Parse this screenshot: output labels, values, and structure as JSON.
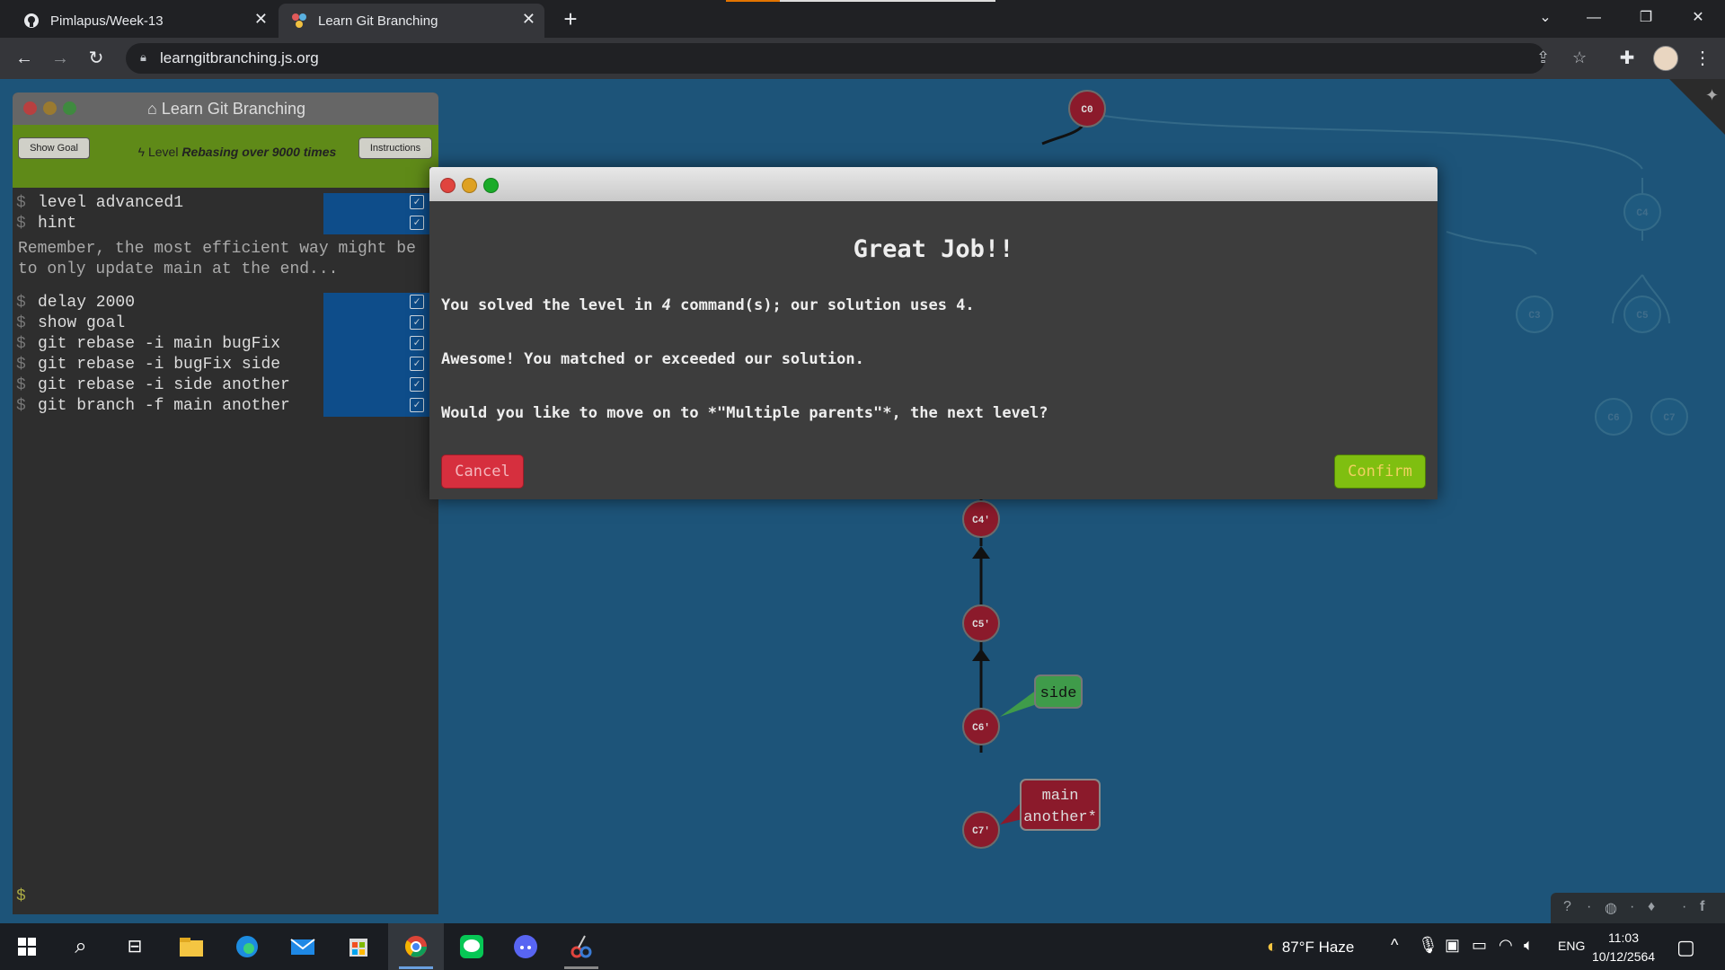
{
  "browser": {
    "tabs": [
      {
        "title": "Pimlapus/Week-13",
        "icon": "github-icon",
        "active": false
      },
      {
        "title": "Learn Git Branching",
        "icon": "lgb-icon",
        "active": true
      }
    ],
    "url": "learngitbranching.js.org"
  },
  "panel": {
    "title": "Learn Git Branching",
    "show_goal": "Show Goal",
    "instructions": "Instructions",
    "level_prefix": "Level",
    "level_name": "Rebasing over 9000 times",
    "commands_top": [
      "level advanced1",
      "hint"
    ],
    "hint": "Remember, the most efficient way might be to only update main at the end...",
    "commands": [
      "delay 2000",
      "show goal",
      "git rebase -i main bugFix",
      "git rebase -i bugFix side",
      "git rebase -i side another",
      "git branch -f main another"
    ],
    "prompt": "$"
  },
  "tree": {
    "commits": [
      "C0",
      "C4'",
      "C5'",
      "C6'",
      "C7'"
    ],
    "faded_commits": [
      "C4",
      "C3",
      "C5",
      "C6",
      "C7"
    ],
    "branches": {
      "side": "side",
      "main": "main",
      "another": "another*"
    },
    "colors": {
      "commit": "#8b1a2b",
      "side_branch": "#3f9b4a",
      "main_branch": "#8b1a2b",
      "background": "#1d5479"
    }
  },
  "modal": {
    "title": "Great Job!!",
    "line1_pre": "You solved the level in ",
    "line1_count": "4",
    "line1_post": " command(s); our solution uses 4.",
    "line2": "Awesome! You matched or exceeded our solution.",
    "line3": "Would you like to move on to *\"Multiple parents\"*, the next level?",
    "cancel": "Cancel",
    "confirm": "Confirm"
  },
  "taskbar": {
    "weather": "87°F  Haze",
    "language": "ENG",
    "time": "11:03",
    "date": "10/12/2564"
  }
}
